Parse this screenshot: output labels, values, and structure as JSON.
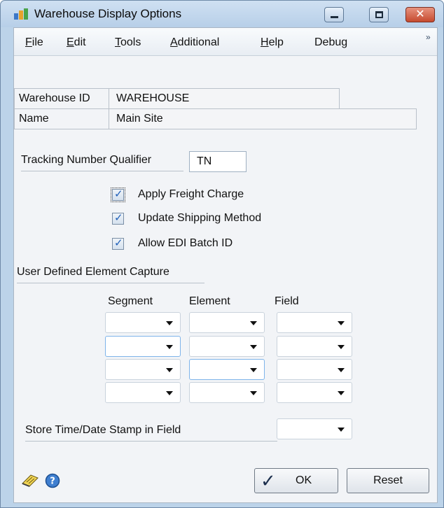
{
  "window": {
    "title": "Warehouse Display Options",
    "close_glyph": "✕"
  },
  "menu": {
    "items": [
      {
        "label": "File",
        "accel": "F",
        "rest": "ile"
      },
      {
        "label": "Edit",
        "accel": "E",
        "rest": "dit"
      },
      {
        "label": "Tools",
        "accel": "T",
        "rest": "ools"
      },
      {
        "label": "Additional",
        "accel": "A",
        "rest": "dditional"
      },
      {
        "label": "Help",
        "accel": "H",
        "rest": "elp"
      },
      {
        "label": "Debug",
        "pre": "Debu",
        "accel": "g"
      }
    ],
    "overflow_glyph": "»"
  },
  "fields": {
    "warehouse_id_label": "Warehouse ID",
    "warehouse_id_value": "WAREHOUSE",
    "name_label": "Name",
    "name_value": "Main Site",
    "tracking_label": "Tracking Number Qualifier",
    "tracking_value": "TN"
  },
  "checkboxes": [
    {
      "label": "Apply Freight Charge",
      "checked": true
    },
    {
      "label": "Update Shipping Method",
      "checked": true
    },
    {
      "label": "Allow EDI Batch ID",
      "checked": true
    }
  ],
  "user_defined": {
    "section_label": "User Defined Element Capture",
    "columns": [
      "Segment",
      "Element",
      "Field"
    ],
    "rows": [
      [
        "",
        "",
        ""
      ],
      [
        "",
        "",
        ""
      ],
      [
        "",
        "",
        ""
      ],
      [
        "",
        "",
        ""
      ]
    ]
  },
  "timestamp": {
    "label": "Store Time/Date Stamp in Field",
    "value": ""
  },
  "buttons": {
    "ok_label": "OK",
    "reset_label": "Reset",
    "check_glyph": "✓"
  },
  "icons": [
    "notes-icon",
    "help-icon",
    "app-icon",
    "minimize-icon",
    "maximize-icon",
    "close-icon"
  ]
}
